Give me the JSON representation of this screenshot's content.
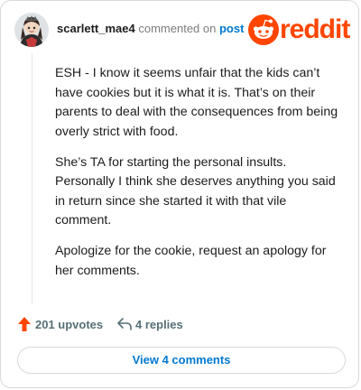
{
  "comment": {
    "username": "scarlett_mae4",
    "action_text": "commented on",
    "post_link": "post",
    "paragraphs": [
      "ESH - I know it seems unfair that the kids can’t have cookies but it is what it is. That’s on their parents to deal with the consequences from being overly strict with food.",
      "She’s TA for starting the personal insults. Personally I think she deserves anything you said in return since she started it with that vile comment.",
      "Apologize for the cookie, request an apology for her comments."
    ]
  },
  "brand": {
    "logo_text": "reddit",
    "logo_icon": "reddit-snoo-icon",
    "accent_color": "#ff4500",
    "link_color": "#0079d3"
  },
  "actions": {
    "upvotes_label": "201 upvotes",
    "upvote_icon": "upvote-arrow-icon",
    "replies_label": "4 replies",
    "reply_icon": "reply-arrow-icon"
  },
  "footer": {
    "view_comments_label": "View 4 comments"
  }
}
